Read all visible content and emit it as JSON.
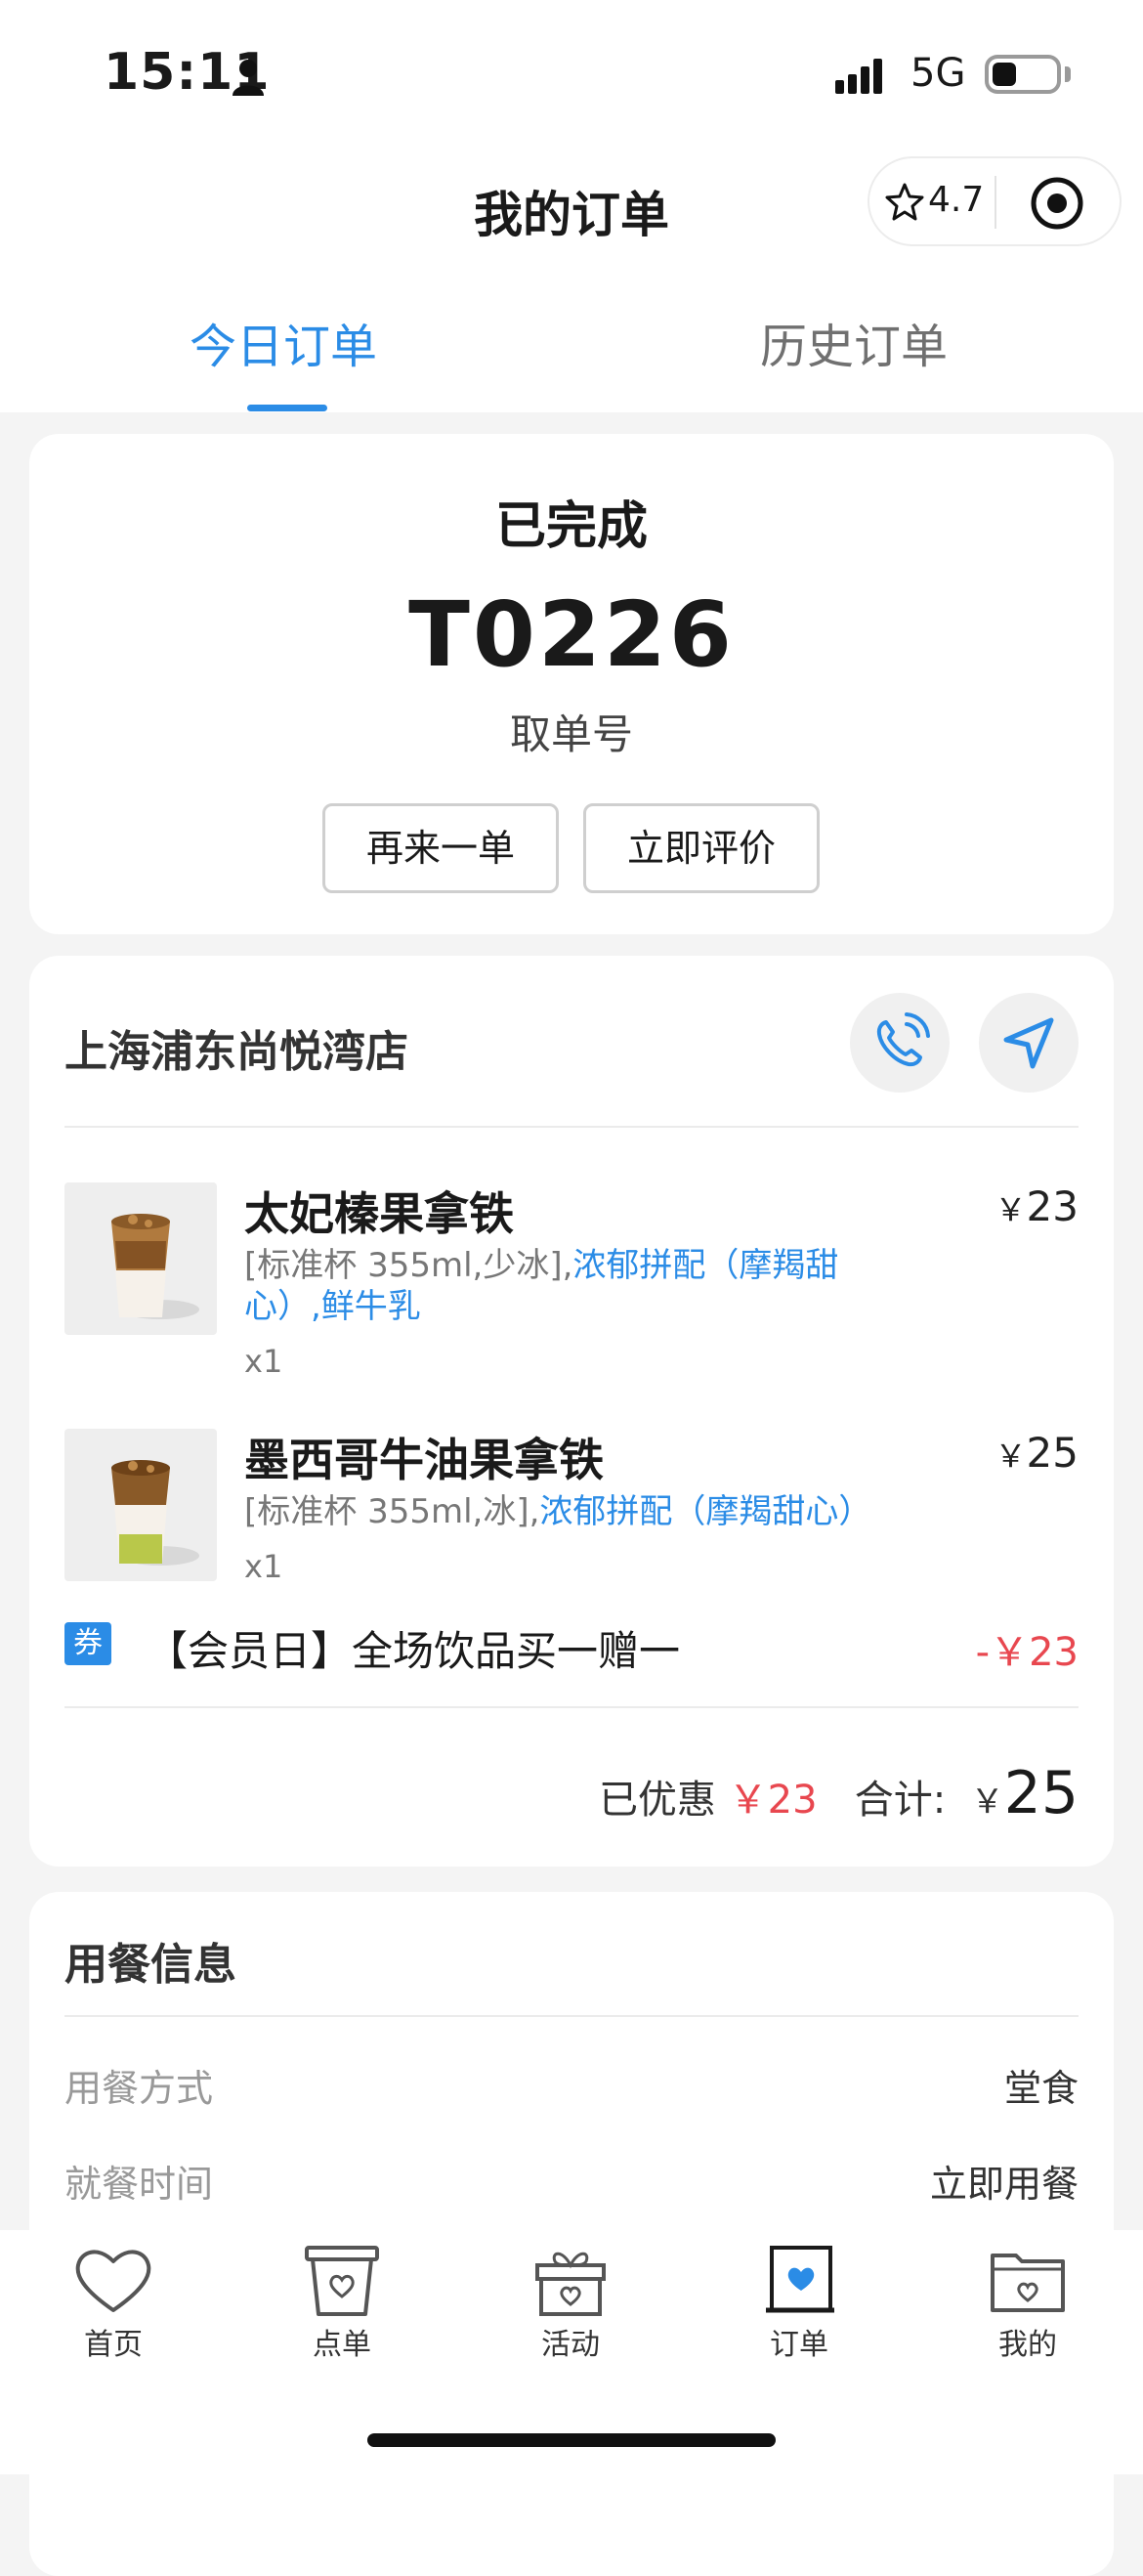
{
  "status_bar": {
    "time": "15:11",
    "network": "5G"
  },
  "header": {
    "title": "我的订单",
    "rating": "4.7"
  },
  "tabs": [
    {
      "label": "今日订单",
      "active": true
    },
    {
      "label": "历史订单",
      "active": false
    }
  ],
  "order": {
    "status": "已完成",
    "pickup_code": "T0226",
    "pickup_label": "取单号",
    "reorder_label": "再来一单",
    "review_label": "立即评价"
  },
  "store": {
    "name": "上海浦东尚悦湾店"
  },
  "items": [
    {
      "name": "太妃榛果拿铁",
      "price": "23",
      "specs_plain": "[标准杯 355ml,少冰],",
      "specs_highlight": "浓郁拼配（摩羯甜心）,鲜牛乳",
      "qty": "x1"
    },
    {
      "name": "墨西哥牛油果拿铁",
      "price": "25",
      "specs_plain": "[标准杯 355ml,冰],",
      "specs_highlight": "浓郁拼配（摩羯甜心）",
      "qty": "x1"
    }
  ],
  "coupon": {
    "badge": "券",
    "text": "【会员日】全场饮品买一赠一",
    "amount": "-￥23"
  },
  "summary": {
    "discount_label": "已优惠",
    "discount": "￥23",
    "total_label": "合计:",
    "currency": "￥",
    "total": "25"
  },
  "dining": {
    "title": "用餐信息",
    "rows": [
      {
        "label": "用餐方式",
        "value": "堂食"
      },
      {
        "label": "就餐时间",
        "value": "立即用餐"
      }
    ]
  },
  "tabbar": [
    {
      "label": "首页",
      "icon": "heart-icon"
    },
    {
      "label": "点单",
      "icon": "cup-icon"
    },
    {
      "label": "活动",
      "icon": "gift-icon"
    },
    {
      "label": "订单",
      "icon": "order-icon",
      "active": true
    },
    {
      "label": "我的",
      "icon": "folder-icon"
    }
  ],
  "colors": {
    "accent": "#2b8ce6",
    "price_red": "#e8474f",
    "background": "#f4f4f4"
  }
}
